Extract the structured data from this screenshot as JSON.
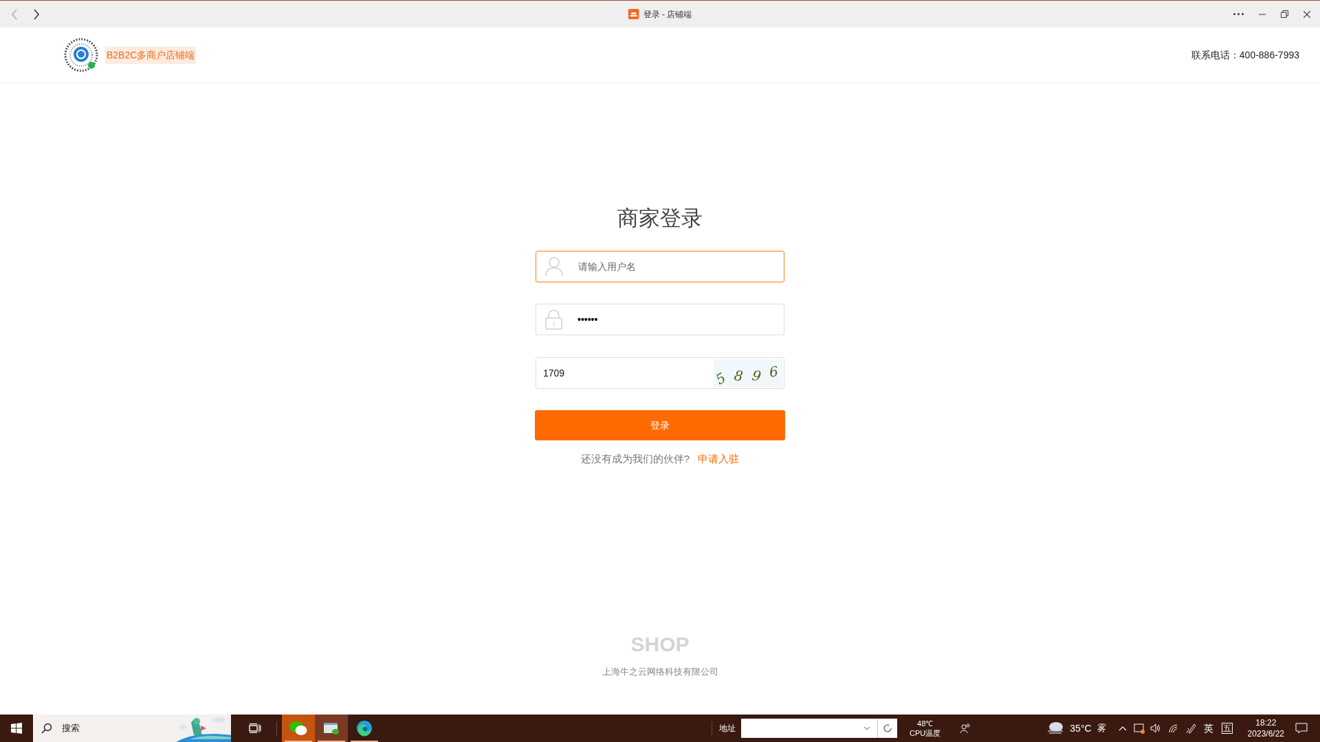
{
  "window": {
    "title": "登录 - 店铺端"
  },
  "header": {
    "brand": "B2B2C多商户店铺端",
    "contact_label": "联系电话：",
    "contact_phone": "400-886-7993"
  },
  "login": {
    "title": "商家登录",
    "fields": [
      {
        "kind": "user",
        "placeholder": "请输入用户名",
        "focused": true
      },
      {
        "kind": "password",
        "value": "••••••",
        "focused": false
      },
      {
        "kind": "captcha",
        "value": "1709",
        "captcha": "5 8 9 6",
        "focused": false
      }
    ],
    "button": "登录",
    "prompt": "还没有成为我们的伙伴?",
    "link": "申请入驻"
  },
  "footer": {
    "logo": "SHOP",
    "company": "上海牛之云网络科技有限公司"
  },
  "taskbar": {
    "search": "搜索",
    "apps": [
      {
        "kind": "wechat",
        "active": true
      },
      {
        "kind": "messenger",
        "active": true
      },
      {
        "kind": "edge",
        "active": true
      }
    ],
    "address_label": "地址",
    "cpu_temp": "48℃",
    "cpu_label": "CPU温度",
    "temperature": "35°C",
    "weather": "雾",
    "ime_lang": "英",
    "ime_mode": "五",
    "time": "18:22",
    "date": "2023/6/22"
  }
}
